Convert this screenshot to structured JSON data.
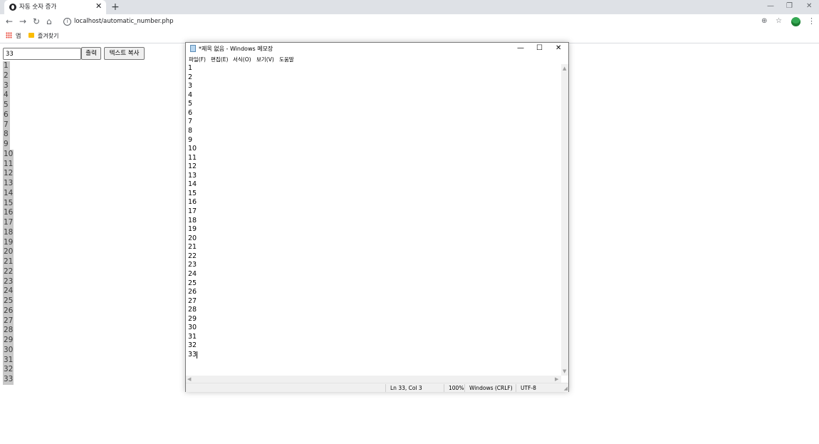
{
  "browser": {
    "tab_title": "자동 숫자 증가",
    "tab_close": "✕",
    "new_tab": "+",
    "window_controls": {
      "minimize": "—",
      "restore": "❐",
      "close": "✕"
    },
    "url": "localhost/automatic_number.php",
    "nav": {
      "back": "←",
      "forward": "→",
      "reload": "↻",
      "home": "⌂",
      "info": "i"
    },
    "right_icons": {
      "zoom": "⊕",
      "bookmark": "☆",
      "menu": "⋮"
    },
    "bookmarks": {
      "apps_label": "앱",
      "folder_label": "즐겨찾기"
    }
  },
  "page": {
    "input_value": "33",
    "print_button": "출력",
    "copy_button": "텍스트 복사",
    "numbers": [
      "1",
      "2",
      "3",
      "4",
      "5",
      "6",
      "7",
      "8",
      "9",
      "10",
      "11",
      "12",
      "13",
      "14",
      "15",
      "16",
      "17",
      "18",
      "19",
      "20",
      "21",
      "22",
      "23",
      "24",
      "25",
      "26",
      "27",
      "28",
      "29",
      "30",
      "31",
      "32",
      "33"
    ]
  },
  "notepad": {
    "title": "*제목 없음 - Windows 메모장",
    "controls": {
      "minimize": "—",
      "maximize": "☐",
      "close": "✕"
    },
    "menu": [
      "파일(F)",
      "편집(E)",
      "서식(O)",
      "보기(V)",
      "도움말"
    ],
    "lines": [
      "1",
      "2",
      "3",
      "4",
      "5",
      "6",
      "7",
      "8",
      "9",
      "10",
      "11",
      "12",
      "13",
      "14",
      "15",
      "16",
      "17",
      "18",
      "19",
      "20",
      "21",
      "22",
      "23",
      "24",
      "25",
      "26",
      "27",
      "28",
      "29",
      "30",
      "31",
      "32",
      "33"
    ],
    "status": {
      "position": "Ln 33, Col 3",
      "zoom": "100%",
      "line_ending": "Windows (CRLF)",
      "encoding": "UTF-8"
    }
  },
  "icons": {
    "favicon": "globe-icon",
    "apps": "apps-grid-icon",
    "folder": "folder-icon",
    "notepad": "notepad-icon"
  }
}
